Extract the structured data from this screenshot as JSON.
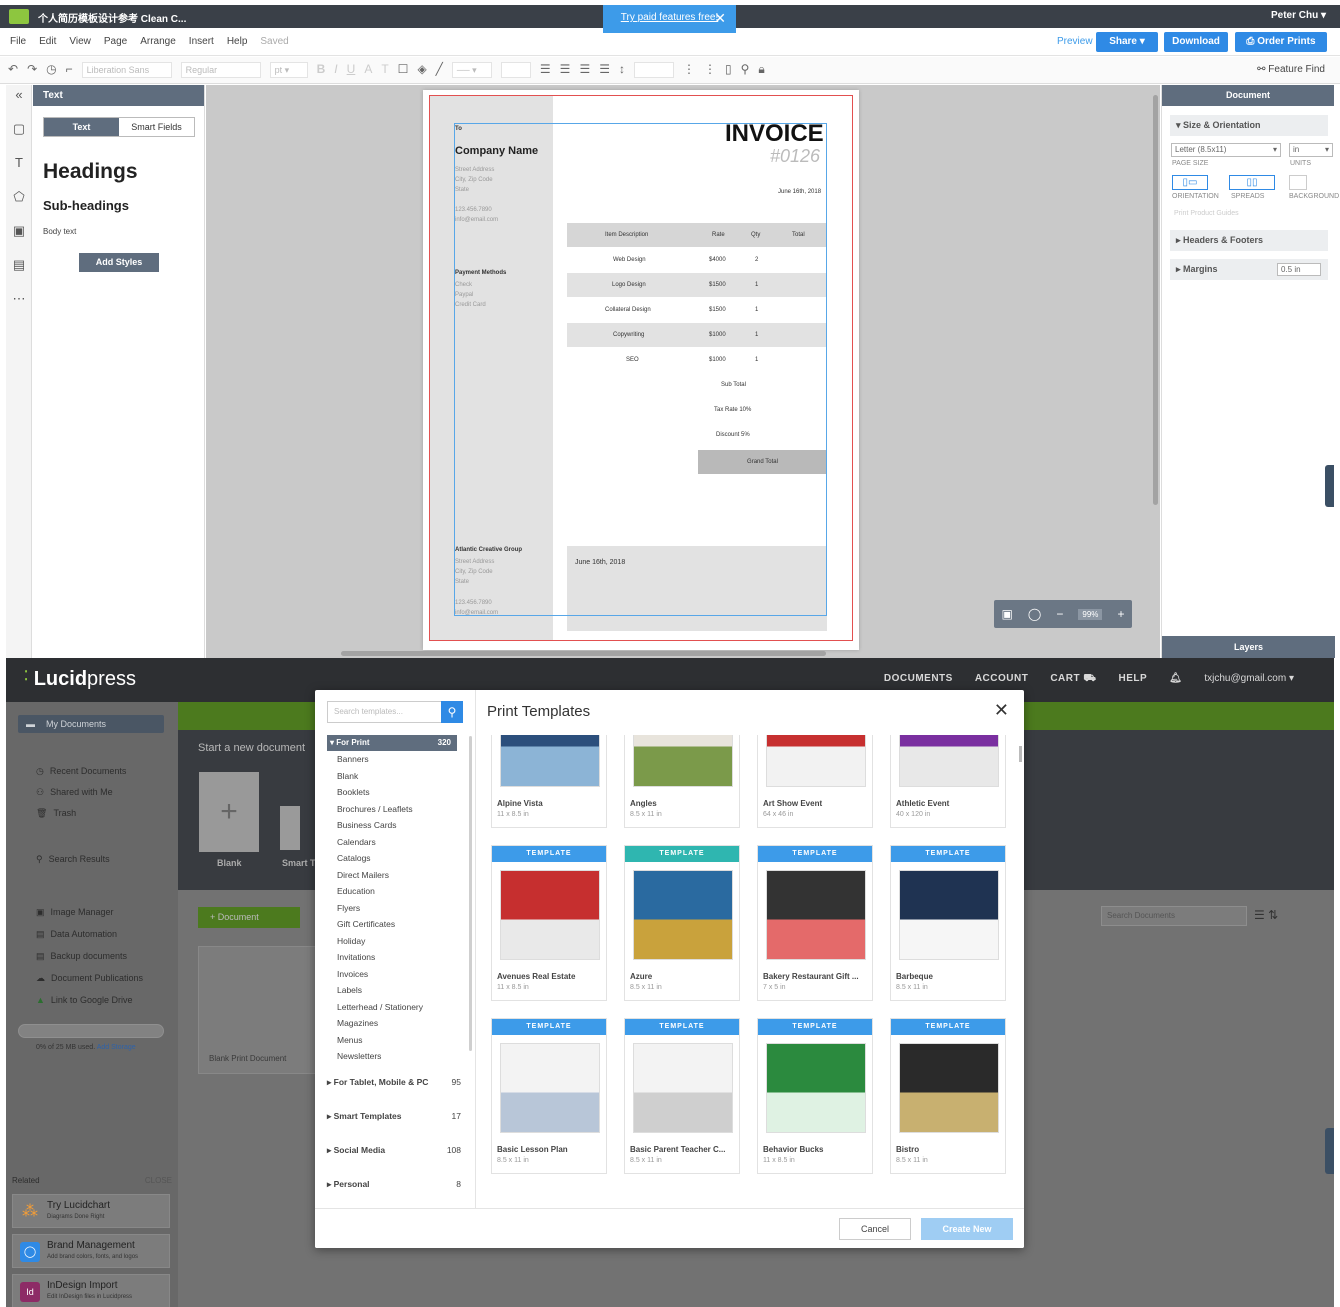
{
  "editor": {
    "doc_title": "个人简历模板设计参考 Clean C...",
    "trial_link": "Try paid features free!",
    "user_name": "Peter Chu ▾",
    "menu": [
      "File",
      "Edit",
      "View",
      "Page",
      "Arrange",
      "Insert",
      "Help"
    ],
    "saved_label": "Saved",
    "preview_label": "Preview",
    "share_label": "Share  ▾",
    "download_label": "Download",
    "order_prints_label": "Order Prints",
    "font_family_placeholder": "Liberation Sans",
    "font_weight_placeholder": "Regular",
    "font_size_placeholder": "pt ▾",
    "feature_find_label": "Feature Find",
    "text_panel": {
      "header": "Text",
      "tab_text": "Text",
      "tab_smart_fields": "Smart Fields",
      "heading_sample": "Headings",
      "subheading_sample": "Sub-headings",
      "body_sample": "Body text",
      "add_styles_label": "Add Styles"
    },
    "document_panel": {
      "header": "Document",
      "size_orientation": "▾ Size & Orientation",
      "page_size_value": "Letter (8.5x11)",
      "units_value": "in",
      "page_size_label": "PAGE SIZE",
      "units_label": "UNITS",
      "orientation_label": "ORIENTATION",
      "spreads_label": "SPREADS",
      "background_label": "BACKGROUND",
      "print_guides_label": "Print Product Guides",
      "headers_footers": "▸ Headers & Footers",
      "margins": "▸ Margins",
      "margins_value": "0.5 in",
      "layers_label": "Layers"
    },
    "zoom_value": "99%",
    "invoice": {
      "to_label": "To",
      "company_name": "Company Name",
      "address_lines": [
        "Street Address",
        "City, Zip Code",
        "State"
      ],
      "phone": "123.456.7890",
      "email": "info@email.com",
      "title": "INVOICE",
      "number": "#0126",
      "date": "June 16th, 2018",
      "col_item": "Item Description",
      "col_rate": "Rate",
      "col_qty": "Qty",
      "col_total": "Total",
      "rows": [
        {
          "item": "Web Design",
          "rate": "$4000",
          "qty": "2"
        },
        {
          "item": "Logo Design",
          "rate": "$1500",
          "qty": "1"
        },
        {
          "item": "Collateral Design",
          "rate": "$1500",
          "qty": "1"
        },
        {
          "item": "Copywriting",
          "rate": "$1000",
          "qty": "1"
        },
        {
          "item": "SEO",
          "rate": "$1000",
          "qty": "1"
        }
      ],
      "sub_total": "Sub Total",
      "tax_rate": "Tax Rate 10%",
      "discount": "Discount 5%",
      "grand_total": "Grand Total",
      "payment_methods": "Payment Methods",
      "payments": [
        "Check",
        "Paypal",
        "Credit Card"
      ],
      "footer_company": "Atlantic Creative Group",
      "footer_address": [
        "Street Address",
        "City, Zip Code",
        "State"
      ],
      "footer_phone": "123.456.7890",
      "footer_email": "info@email.com",
      "footer_date": "June 16th, 2018"
    }
  },
  "lucidpress": {
    "brand": "Lucid",
    "brand_suffix": "press",
    "nav": [
      "DOCUMENTS",
      "ACCOUNT",
      "CART",
      "HELP"
    ],
    "user_email": "txjchu@gmail.com ▾",
    "my_documents": "My Documents",
    "side_items": [
      "Recent Documents",
      "Shared with Me",
      "Trash",
      "Search Results"
    ],
    "tool_items": [
      "Image Manager",
      "Data Automation",
      "Backup documents",
      "Document Publications",
      "Link to Google Drive"
    ],
    "storage_text": "0% of 25 MB used.",
    "add_storage": "Add Storage",
    "related_label": "Related",
    "related_action": "CLOSE",
    "related_cards": [
      {
        "title": "Try Lucidchart",
        "sub": "Diagrams Done Right",
        "color": "#f29d38"
      },
      {
        "title": "Brand Management",
        "sub": "Add brand colors, fonts, and logos",
        "color": "#2f8ae5"
      },
      {
        "title": "InDesign Import",
        "sub": "Edit InDesign files in Lucidpress",
        "color": "#8d2b66"
      }
    ],
    "start_new_doc": "Start a new document",
    "blank_label": "Blank",
    "smart_label": "Smart T",
    "add_document": "+ Document",
    "blank_print_doc": "Blank Print Document",
    "search_documents": "Search Documents"
  },
  "modal": {
    "search_placeholder": "Search templates...",
    "title": "Print Templates",
    "for_print": "▾ For Print",
    "for_print_count": "320",
    "categories": [
      "Banners",
      "Blank",
      "Booklets",
      "Brochures / Leaflets",
      "Business Cards",
      "Calendars",
      "Catalogs",
      "Direct Mailers",
      "Education",
      "Flyers",
      "Gift Certificates",
      "Holiday",
      "Invitations",
      "Invoices",
      "Labels",
      "Letterhead / Stationery",
      "Magazines",
      "Menus",
      "Newsletters"
    ],
    "groups": [
      {
        "name": "▸ For Tablet, Mobile & PC",
        "count": "95"
      },
      {
        "name": "▸ Smart Templates",
        "count": "17"
      },
      {
        "name": "▸ Social Media",
        "count": "108"
      },
      {
        "name": "▸ Personal",
        "count": "8"
      }
    ],
    "tag_label": "TEMPLATE",
    "templates": [
      {
        "name": "Alpine Vista",
        "size": "11 x 8.5 in",
        "tag": false
      },
      {
        "name": "Angles",
        "size": "8.5 x 11 in",
        "tag": false
      },
      {
        "name": "Art Show Event",
        "size": "64 x 46 in",
        "tag": false
      },
      {
        "name": "Athletic Event",
        "size": "40 x 120 in",
        "tag": false
      },
      {
        "name": "Avenues Real Estate",
        "size": "11 x 8.5 in",
        "tag": true
      },
      {
        "name": "Azure",
        "size": "8.5 x 11 in",
        "tag": true
      },
      {
        "name": "Bakery Restaurant Gift ...",
        "size": "7 x 5 in",
        "tag": true
      },
      {
        "name": "Barbeque",
        "size": "8.5 x 11 in",
        "tag": true
      },
      {
        "name": "Basic Lesson Plan",
        "size": "8.5 x 11 in",
        "tag": true
      },
      {
        "name": "Basic Parent Teacher C...",
        "size": "8.5 x 11 in",
        "tag": true
      },
      {
        "name": "Behavior Bucks",
        "size": "11 x 8.5 in",
        "tag": true
      },
      {
        "name": "Bistro",
        "size": "8.5 x 11 in",
        "tag": true
      }
    ],
    "cancel_label": "Cancel",
    "create_label": "Create New"
  }
}
